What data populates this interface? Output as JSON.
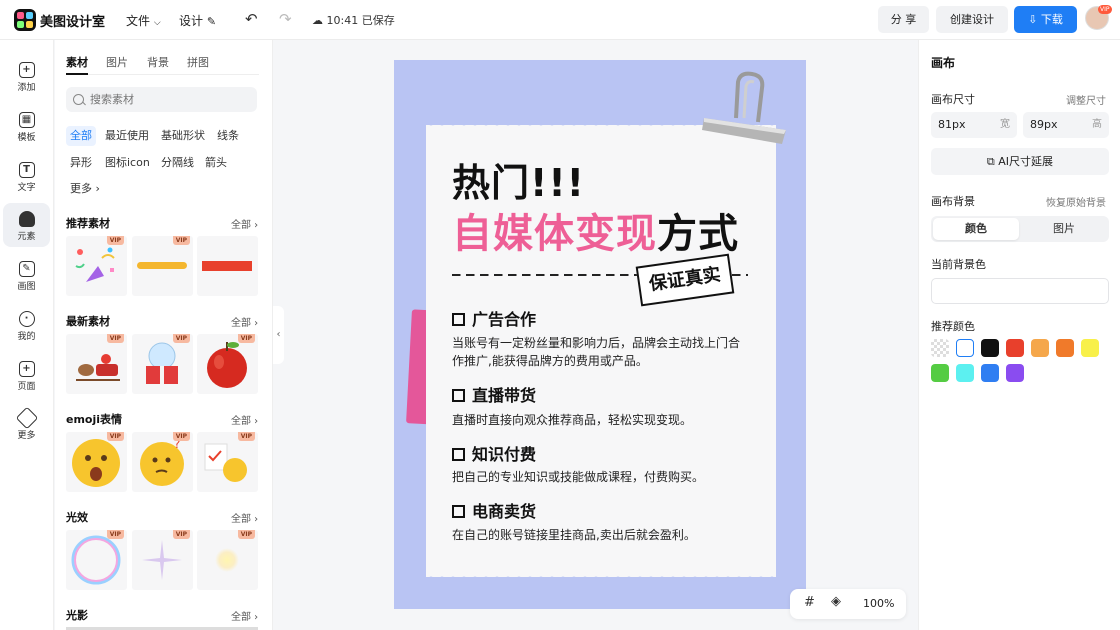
{
  "app": {
    "title": "美图设计室"
  },
  "topbar": {
    "file_label": "文件",
    "design_label": "设计",
    "save_status": "10:41 已保存",
    "share_label": "分 享",
    "create_label": "创建设计",
    "download_label": "下载",
    "avatar_badge": "VIP"
  },
  "rail": {
    "items": [
      {
        "label": "添加",
        "icon": "plus-icon"
      },
      {
        "label": "模板",
        "icon": "template-icon"
      },
      {
        "label": "文字",
        "icon": "text-icon"
      },
      {
        "label": "元素",
        "icon": "shapes-icon"
      },
      {
        "label": "画图",
        "icon": "draw-icon"
      },
      {
        "label": "我的",
        "icon": "user-icon"
      },
      {
        "label": "页面",
        "icon": "page-icon"
      },
      {
        "label": "更多",
        "icon": "cube-icon"
      }
    ],
    "active": 3
  },
  "panel": {
    "tabs": [
      "素材",
      "图片",
      "背景",
      "拼图"
    ],
    "search_placeholder": "搜索素材",
    "chips": [
      "全部",
      "最近使用",
      "基础形状",
      "线条",
      "异形",
      "图标icon",
      "分隔线",
      "箭头",
      "更多"
    ],
    "more_label": "全部",
    "vip": "VIP",
    "sections": [
      {
        "title": "推荐素材",
        "items": [
          "confetti-popper",
          "yellow-brush-stroke",
          "red-bar"
        ]
      },
      {
        "title": "最新素材",
        "items": [
          "santa-sleigh",
          "snow-globe-gift",
          "red-apple"
        ]
      },
      {
        "title": "emoji表情",
        "items": [
          "shocked-emoji",
          "thinking-emoji",
          "checklist-emoji"
        ]
      },
      {
        "title": "光效",
        "items": [
          "rainbow-bubble",
          "sparkle-star",
          "glow-light"
        ]
      },
      {
        "title": "光影",
        "items": []
      }
    ]
  },
  "canvas": {
    "heading_line1": "热门!!!",
    "heading_pink": "自媒体变现",
    "heading_rest": "方式",
    "stamp": "保证真实",
    "items": [
      {
        "title": "广告合作",
        "desc": "当账号有一定粉丝量和影响力后，品牌会主动找上门合作推广,能获得品牌方的费用或产品。"
      },
      {
        "title": "直播带货",
        "desc": "直播时直接向观众推荐商品，轻松实现变现。"
      },
      {
        "title": "知识付费",
        "desc": "把自己的专业知识或技能做成课程，付费购买。"
      },
      {
        "title": "电商卖货",
        "desc": "在自己的账号链接里挂商品,卖出后就会盈利。"
      }
    ],
    "zoom": "100%",
    "colors": {
      "background": "#b9c4f3",
      "pink": "#ee5f96"
    }
  },
  "right": {
    "title": "画布",
    "size_label": "画布尺寸",
    "size_link": "调整尺寸",
    "width_value": "81px",
    "width_unit": "宽",
    "height_value": "89px",
    "height_unit": "高",
    "ai_extend": "AI尺寸延展",
    "bg_label": "画布背景",
    "bg_reset": "恢复原始背景",
    "seg_color": "颜色",
    "seg_image": "图片",
    "current_bg_label": "当前背景色",
    "recommend_label": "推荐颜色",
    "swatches": [
      "transparent",
      "#ffffff",
      "#111111",
      "#e8402c",
      "#f5a74b",
      "#f07a2a",
      "#f8f04a",
      "#55cc43",
      "#5cf0f0",
      "#2f7ef2",
      "#8a4cf0"
    ]
  }
}
